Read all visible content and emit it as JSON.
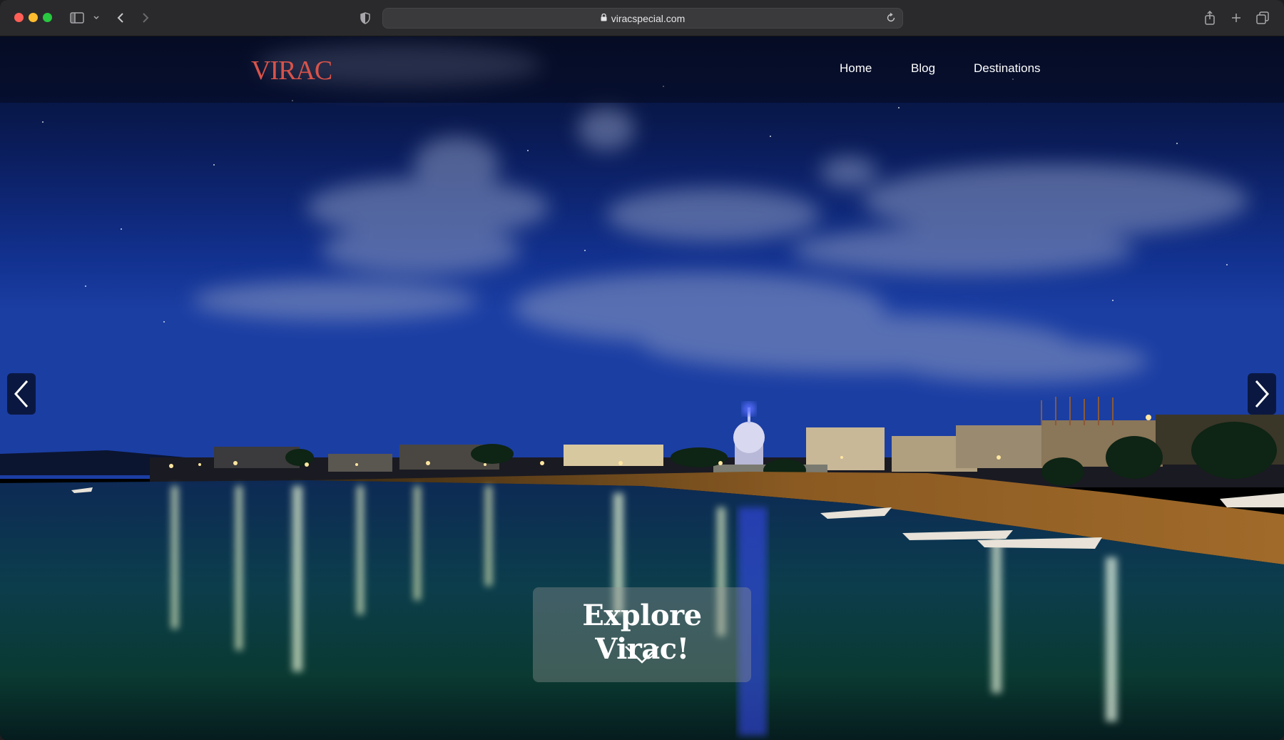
{
  "browser": {
    "url": "viracspecial.com",
    "icons": [
      "sidebar-icon",
      "chevron-down-icon",
      "back-icon",
      "forward-icon",
      "shield-icon",
      "lock-icon",
      "reload-icon",
      "share-icon",
      "plus-icon",
      "tabs-icon"
    ]
  },
  "site": {
    "logo": "VIRAC",
    "nav": {
      "home": "Home",
      "blog": "Blog",
      "destinations": "Destinations"
    },
    "hero": {
      "cta_title": "Explore Virac!"
    }
  },
  "colors": {
    "logo": "#d9534a",
    "nav_text": "#ffffff",
    "chrome_bg": "#2a2a2c"
  }
}
